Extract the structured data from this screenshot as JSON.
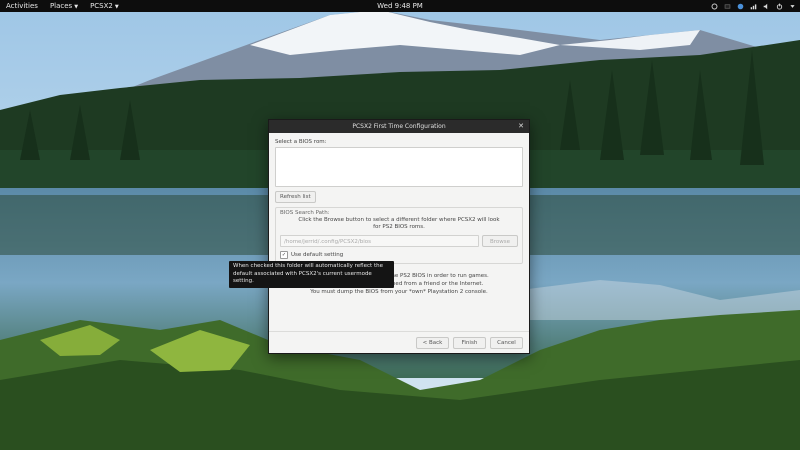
{
  "topbar": {
    "activities": "Activities",
    "places": "Places",
    "app_menu": "PCSX2",
    "clock": "Wed 9:48 PM"
  },
  "dialog": {
    "title": "PCSX2 First Time Configuration",
    "bios_rom_label": "Select a BIOS rom:",
    "refresh_button": "Refresh list",
    "search_path_title": "BIOS Search Path:",
    "search_help_line1": "Click the Browse button to select a different folder where PCSX2 will look",
    "search_help_line2": "for PS2 BIOS roms.",
    "path_value": "/home/jerrid/.config/PCSX2/bios",
    "browse_button": "Browse",
    "use_default_label": "Use default setting",
    "info_line1": "the PS2 BIOS in order to run games.",
    "info_line2": "You cannot use a copy obtained from a friend or the Internet.",
    "info_line3": "You must dump the BIOS from your *own* Playstation 2 console.",
    "back_button": "< Back",
    "finish_button": "Finish",
    "cancel_button": "Cancel"
  },
  "tooltip": {
    "line1": "When checked this folder will automatically reflect the",
    "line2": "default associated with PCSX2's current usermode setting."
  },
  "icons": [
    "power-icon",
    "volume-icon",
    "network-icon",
    "settings-icon",
    "chevron-down-icon",
    "close-icon",
    "check-icon"
  ],
  "colors": {
    "topbar_bg": "#0d0d0d",
    "titlebar_bg": "#2b2b2b",
    "dialog_bg": "#f4f4f3",
    "tooltip_bg": "#141414"
  }
}
